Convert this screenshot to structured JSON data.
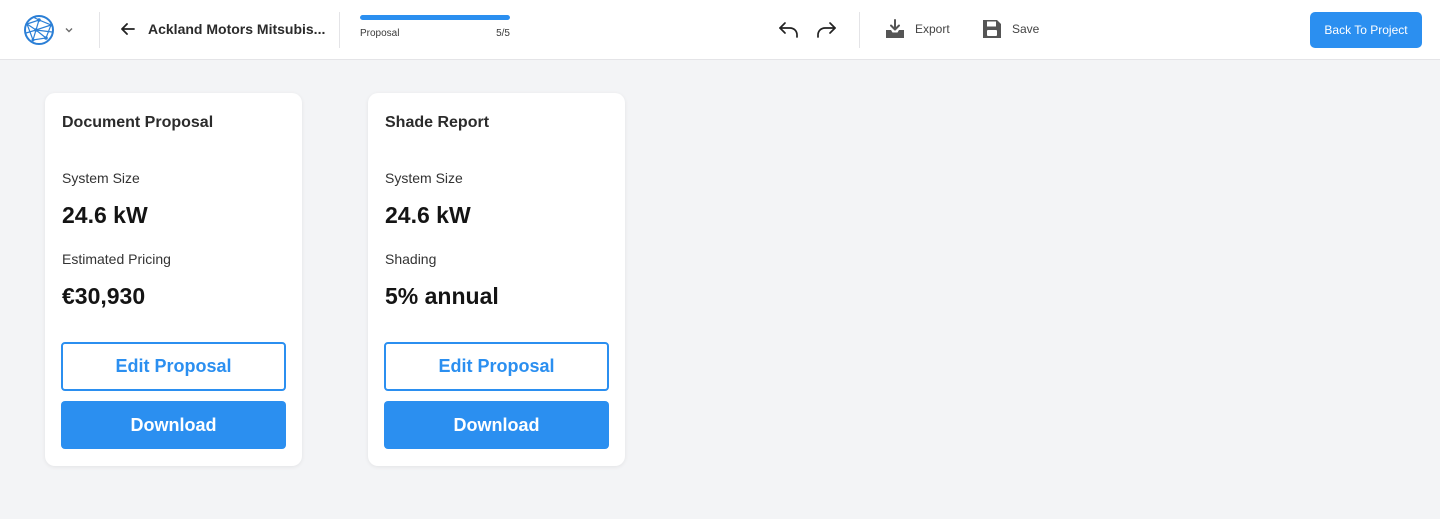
{
  "header": {
    "project_title": "Ackland Motors Mitsubis...",
    "progress": {
      "label": "Proposal",
      "step_text": "5/5",
      "fraction": 1.0
    },
    "export_label": "Export",
    "save_label": "Save",
    "back_button_label": "Back To Project"
  },
  "cards": [
    {
      "title": "Document Proposal",
      "metric1_label": "System Size",
      "metric1_value": "24.6 kW",
      "metric2_label": "Estimated Pricing",
      "metric2_value": "€30,930",
      "edit_label": "Edit Proposal",
      "download_label": "Download"
    },
    {
      "title": "Shade Report",
      "metric1_label": "System Size",
      "metric1_value": "24.6 kW",
      "metric2_label": "Shading",
      "metric2_value": "5% annual",
      "edit_label": "Edit Proposal",
      "download_label": "Download"
    }
  ],
  "icons": {
    "logo": "globe-mesh-icon",
    "logo_menu": "chevron-down-icon",
    "back": "arrow-left-icon",
    "undo": "undo-icon",
    "redo": "redo-icon",
    "export": "download-tray-icon",
    "save": "floppy-disk-icon"
  },
  "colors": {
    "accent": "#2b8ff0",
    "background": "#f3f4f6",
    "card": "#ffffff",
    "logo": "#2b7fd6"
  }
}
